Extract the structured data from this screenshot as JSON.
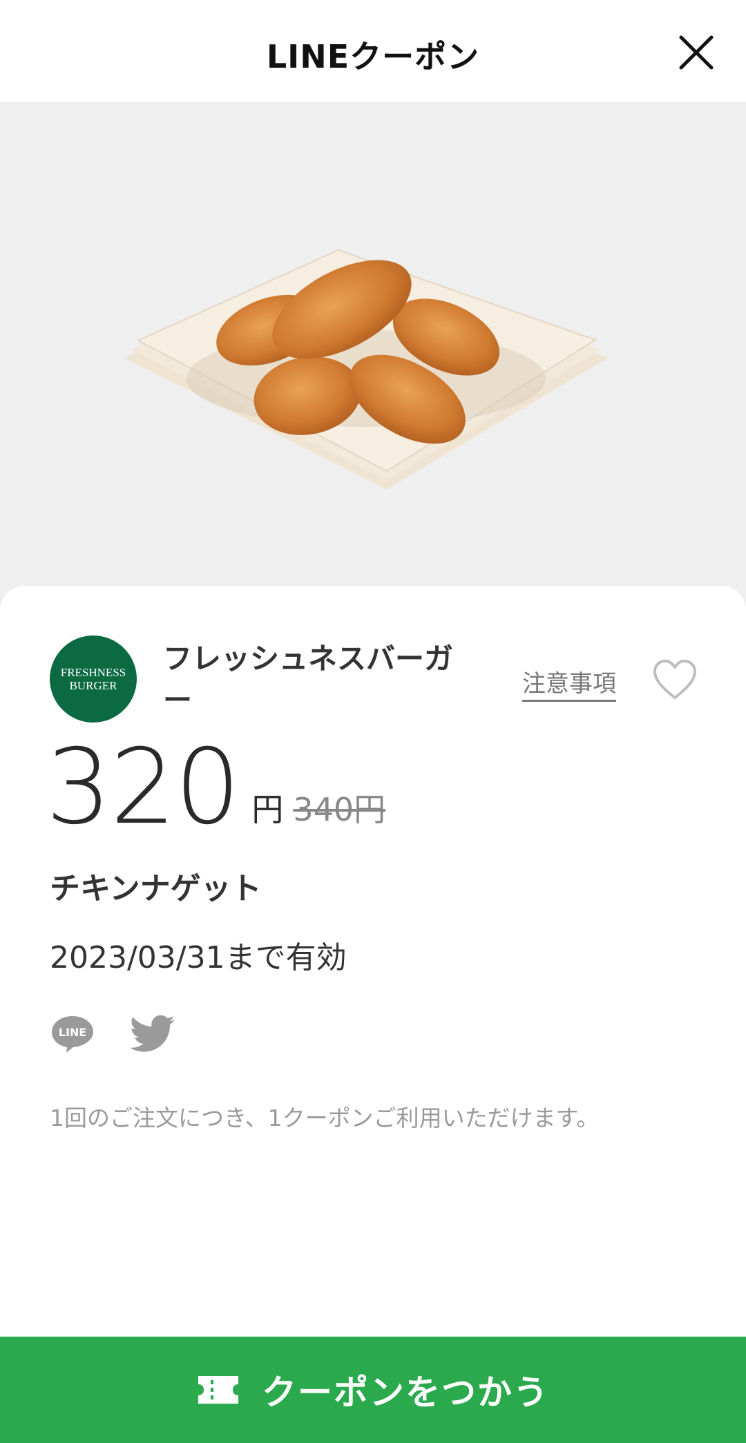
{
  "header": {
    "title": "LINEクーポン",
    "close_icon": "close-icon"
  },
  "hero": {
    "image_alt": "chicken nuggets photo"
  },
  "coupon": {
    "logo_line1": "FRESHNESS",
    "logo_line2": "BURGER",
    "shop_name": "フレッシュネスバーガー",
    "notes_link": "注意事項",
    "price": "320",
    "price_unit": "円",
    "original_price": "340円",
    "product_name": "チキンナゲット",
    "validity": "2023/03/31まで有効",
    "note": "1回のご注文につき、1クーポンご利用いただけます。",
    "share": {
      "line_label": "LINE",
      "line_icon": "line-share-icon",
      "twitter_icon": "twitter-share-icon"
    }
  },
  "cta": {
    "label": "クーポンをつかう",
    "icon": "ticket-icon"
  },
  "colors": {
    "brand_green": "#2aaa4d",
    "logo_green": "#0c6a43",
    "hero_bg": "#efefef"
  }
}
